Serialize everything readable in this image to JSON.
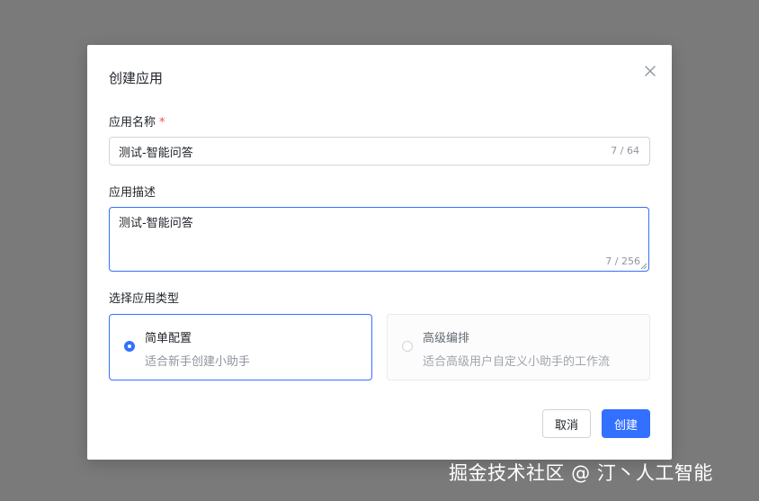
{
  "dialog": {
    "title": "创建应用",
    "close_icon": "close-icon"
  },
  "form": {
    "name_label": "应用名称",
    "required_mark": "*",
    "name_value": "测试-智能问答",
    "name_counter": "7 / 64",
    "desc_label": "应用描述",
    "desc_value": "测试-智能问答",
    "desc_counter": "7 / 256",
    "type_label": "选择应用类型"
  },
  "app_types": [
    {
      "title": "简单配置",
      "description": "适合新手创建小助手",
      "selected": true
    },
    {
      "title": "高级编排",
      "description": "适合高级用户自定义小助手的工作流",
      "selected": false
    }
  ],
  "buttons": {
    "cancel": "取消",
    "create": "创建"
  },
  "colors": {
    "accent": "#3370ff",
    "required": "#f54a45",
    "overlay": "#7a7a7a"
  },
  "watermark": "掘金技术社区 @ 汀丶人工智能"
}
